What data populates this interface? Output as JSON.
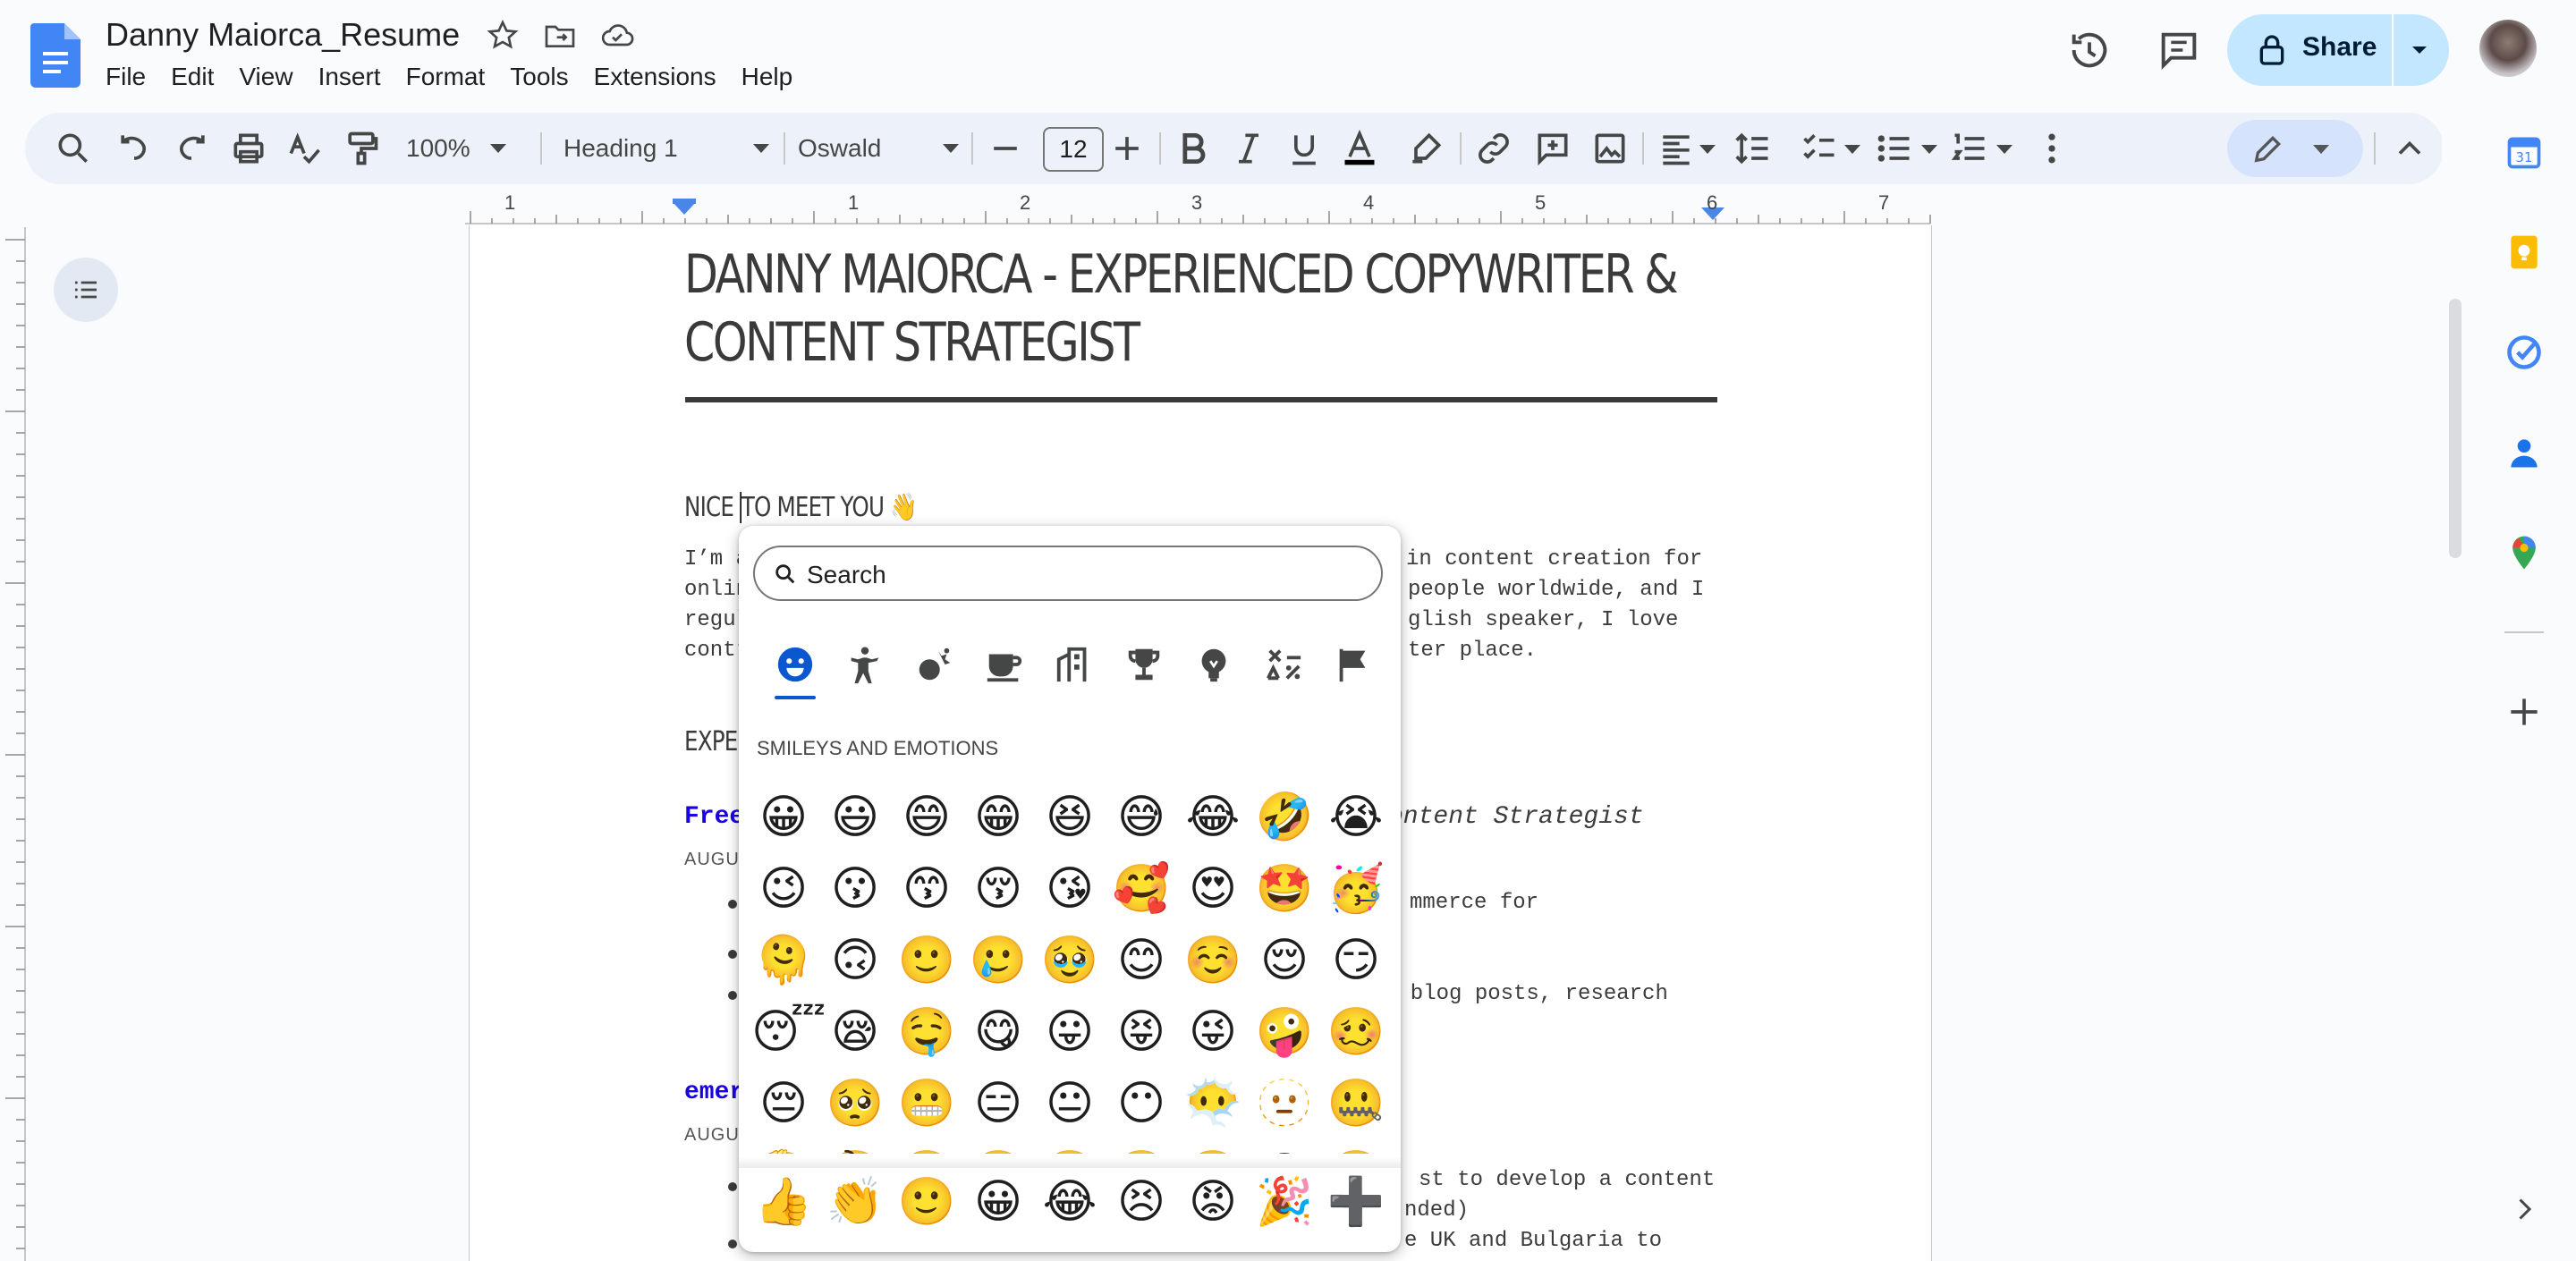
{
  "header": {
    "doc_title": "Danny Maiorca_Resume",
    "menu": [
      "File",
      "Edit",
      "View",
      "Insert",
      "Format",
      "Tools",
      "Extensions",
      "Help"
    ],
    "share_label": "Share"
  },
  "toolbar": {
    "zoom": "100%",
    "style": "Heading 1",
    "font": "Oswald",
    "font_size": "12"
  },
  "ruler": {
    "labels": [
      "1",
      "1",
      "2",
      "3",
      "4",
      "5",
      "6",
      "7"
    ]
  },
  "document": {
    "title_line1": "DANNY MAIORCA - EXPERIENCED COPYWRITER &",
    "title_line2": "CONTENT STRATEGIST",
    "section1_heading_a": "NICE ",
    "section1_heading_b": "TO MEET YOU",
    "section1_emoji": "👋",
    "para_lines_left": [
      "I’m a",
      "onlin",
      "regul",
      "contr"
    ],
    "para_lines_right": [
      "in content creation for",
      "people worldwide, and I",
      "glish speaker, I love",
      "ter place."
    ],
    "section2_heading": "EXPER",
    "job1_company": "Free",
    "job1_title": "ontent Strategist",
    "job1_date": "AUGUS",
    "job1_bullets_right": [
      "mmerce for",
      "m blog posts, research"
    ],
    "job2_company": "emer",
    "job2_date": "AUGUS",
    "job2_bullets_right": [
      "st to develop a content",
      "nded)",
      "e UK and Bulgaria to"
    ]
  },
  "emoji_picker": {
    "search_placeholder": "Search",
    "categories": [
      "smileys-icon",
      "people-icon",
      "activities-icon",
      "food-icon",
      "travel-icon",
      "objects-icon",
      "symbols-icon",
      "symbols2-icon",
      "flags-icon"
    ],
    "section_label": "SMILEYS AND EMOTIONS",
    "rows": [
      [
        "😀",
        "😃",
        "😄",
        "😁",
        "😆",
        "😅",
        "😂",
        "🤣",
        "😭"
      ],
      [
        "😉",
        "😗",
        "😙",
        "😚",
        "😘",
        "🥰",
        "😍",
        "🤩",
        "🥳"
      ],
      [
        "🫠",
        "🙃",
        "🙂",
        "🥲",
        "🥹",
        "😊",
        "☺️",
        "😌",
        "😏"
      ],
      [
        "😴",
        "😪",
        "🤤",
        "😋",
        "😛",
        "😝",
        "😜",
        "🤪",
        "🥴"
      ],
      [
        "😔",
        "🥺",
        "😬",
        "😑",
        "😐",
        "😶",
        "😶‍🌫️",
        "🫥",
        "🤐"
      ],
      [
        "🫡",
        "🤔",
        "🤫",
        "🫢",
        "🤭",
        "🥱",
        "🤗",
        "😱",
        "🤨"
      ]
    ],
    "recent": [
      "👍",
      "👏",
      "🙂",
      "😀",
      "😂",
      "😣",
      "😡",
      "🎉",
      "➕"
    ]
  },
  "colors": {
    "accent": "#0b57d0",
    "share_bg": "#c2e7ff",
    "link_blue": "#1a00e6"
  }
}
